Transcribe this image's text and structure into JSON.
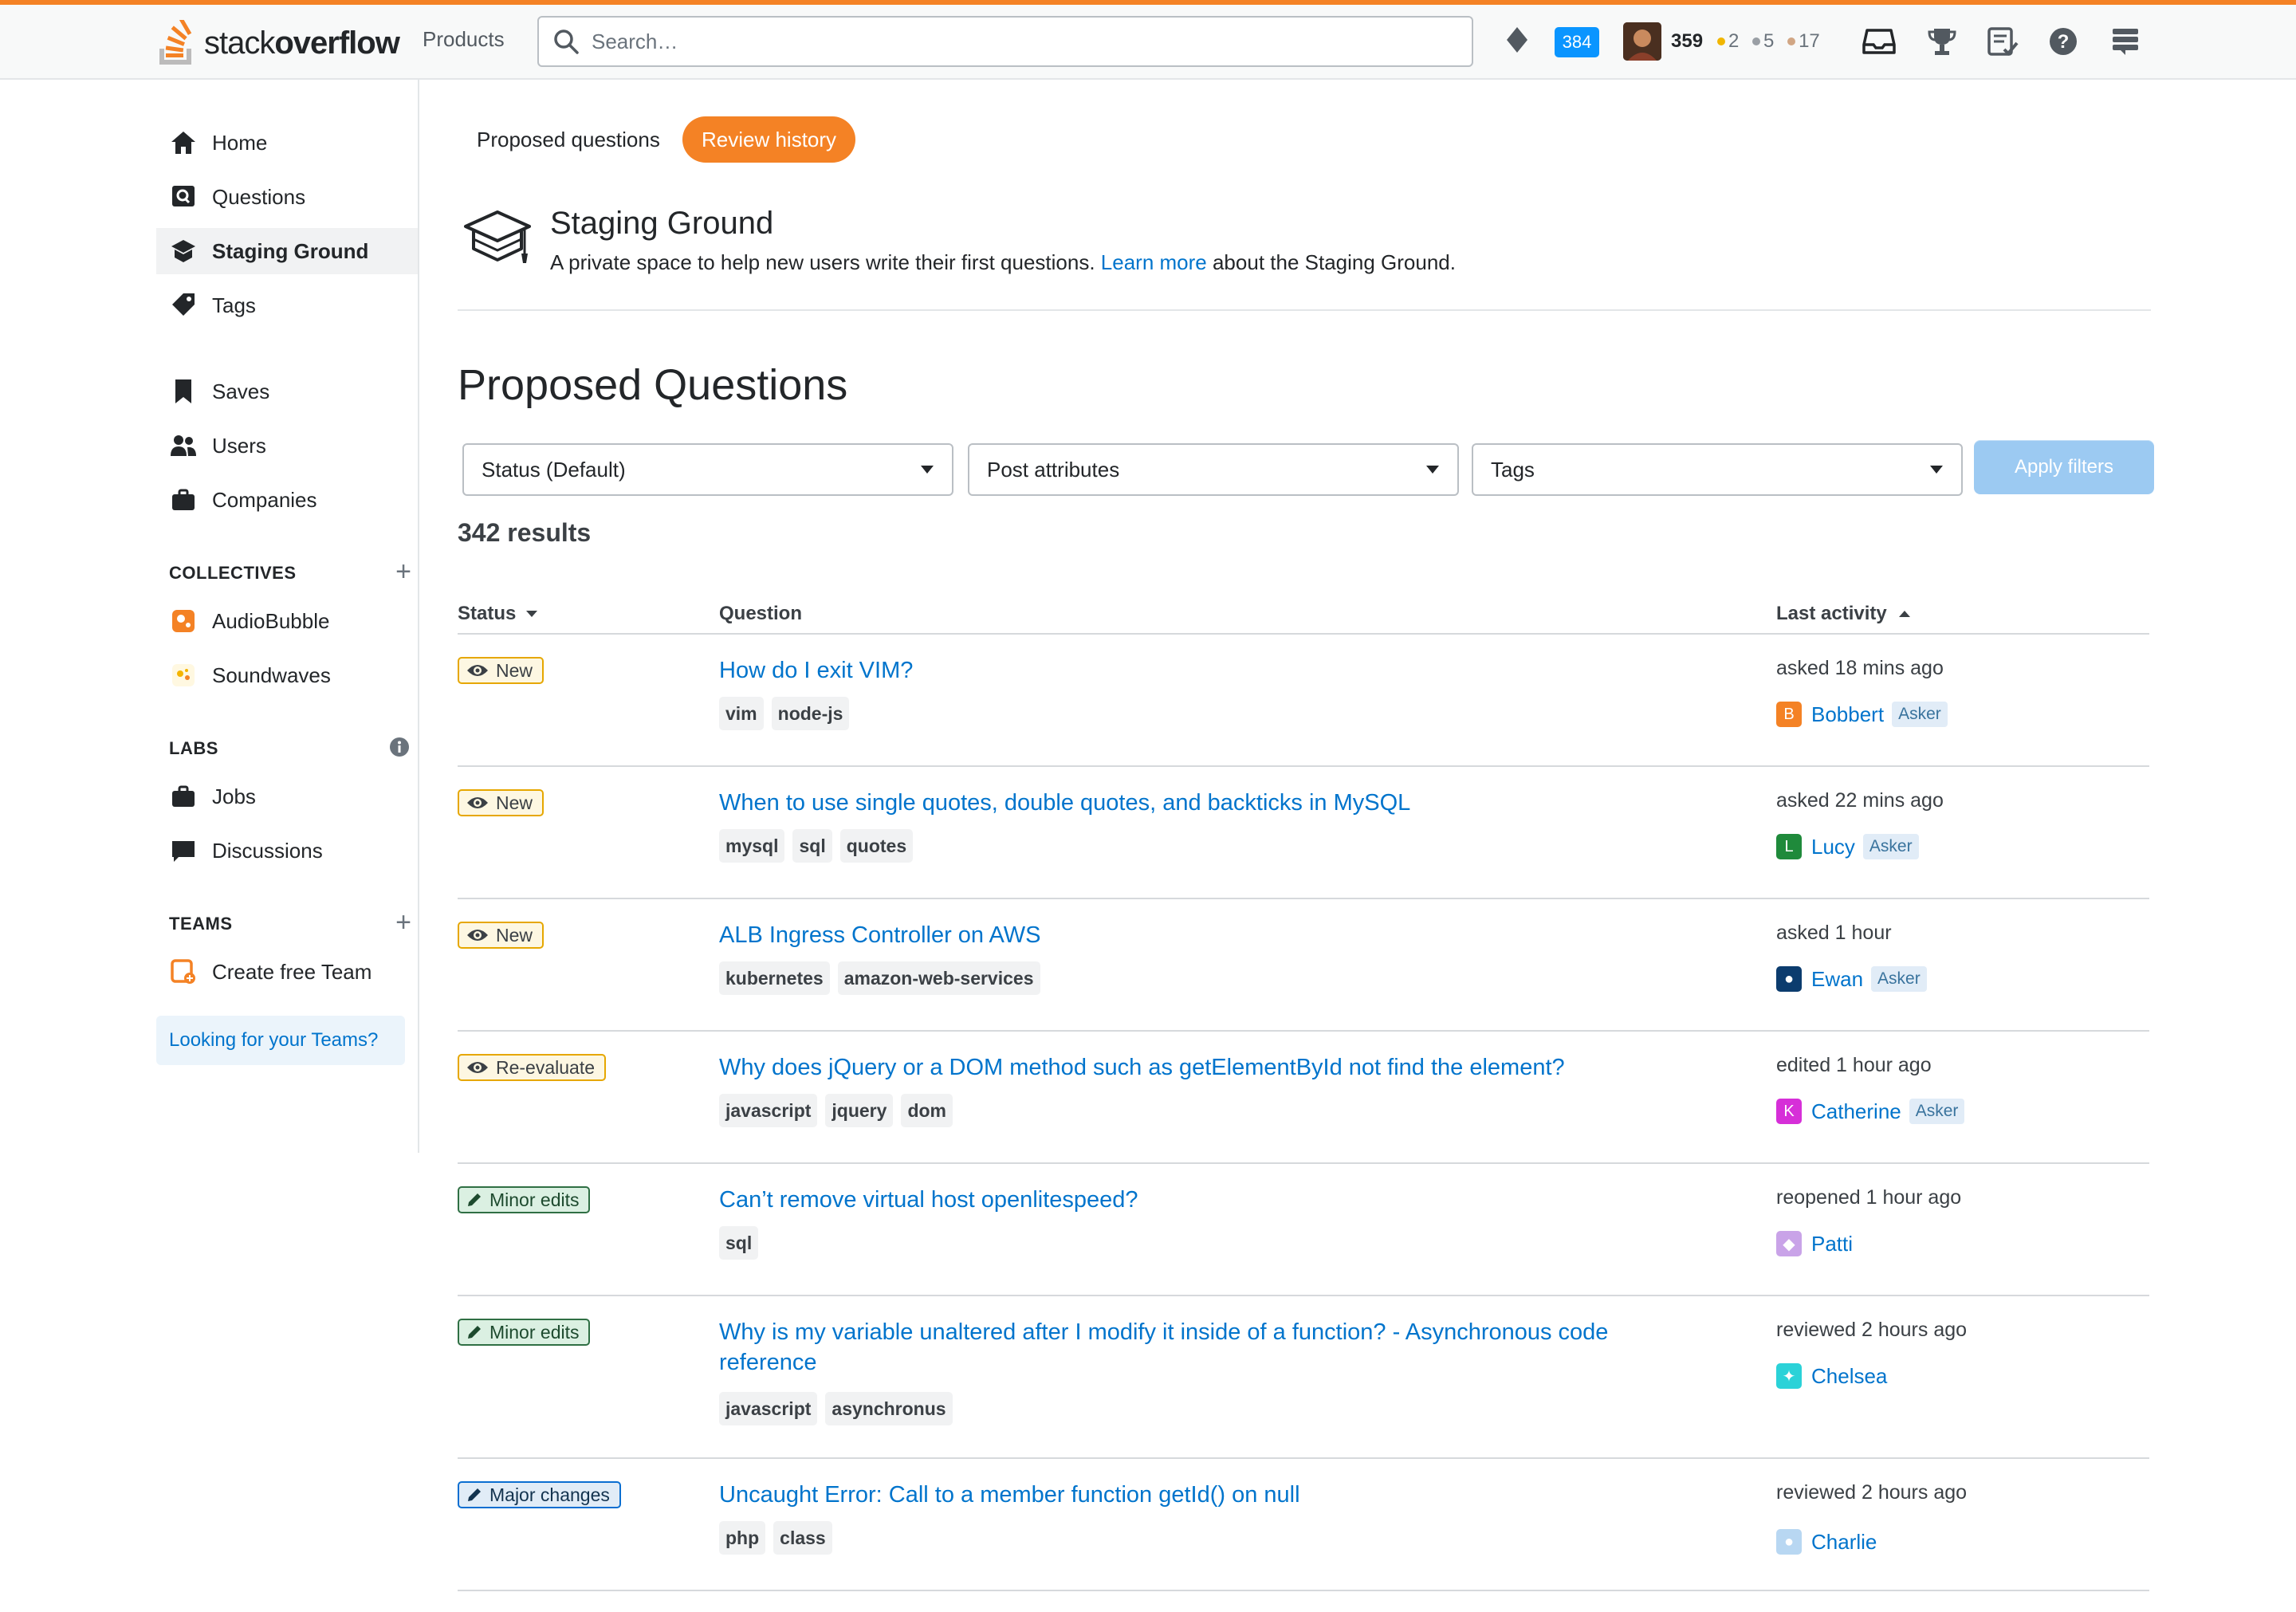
{
  "topbar": {
    "logo_light": "stack",
    "logo_bold": "overflow",
    "products": "Products",
    "search_placeholder": "Search…",
    "inbox_count": "384",
    "reputation": "359",
    "gold": "2",
    "silver": "5",
    "bronze": "17"
  },
  "sidebar": {
    "home": "Home",
    "questions": "Questions",
    "staging": "Staging Ground",
    "tags": "Tags",
    "saves": "Saves",
    "users": "Users",
    "companies": "Companies",
    "collectives_heading": "COLLECTIVES",
    "collective_1": "AudioBubble",
    "collective_2": "Soundwaves",
    "labs_heading": "LABS",
    "jobs": "Jobs",
    "discussions": "Discussions",
    "teams_heading": "TEAMS",
    "create_team": "Create free Team",
    "teams_link": "Looking for your Teams?"
  },
  "main": {
    "tab_proposed": "Proposed questions",
    "tab_history": "Review history",
    "sg_title": "Staging Ground",
    "sg_desc_pre": "A private space to help new users write their first questions. ",
    "sg_learn_more": "Learn more",
    "sg_desc_post": " about the Staging Ground.",
    "heading": "Proposed Questions",
    "filter_status": "Status (Default)",
    "filter_attributes": "Post attributes",
    "filter_tags": "Tags",
    "apply": "Apply filters",
    "results": "342 results",
    "col_status": "Status",
    "col_question": "Question",
    "col_activity": "Last activity"
  },
  "rows": [
    {
      "status": "New",
      "title": "How do I exit VIM?",
      "tags": [
        "vim",
        "node-js"
      ],
      "activity": "asked 18 mins ago",
      "user": "Bobbert",
      "initial": "B",
      "avatar_color": "#f48225",
      "asker": "Asker"
    },
    {
      "status": "New",
      "title": "When to use single quotes, double quotes, and backticks in MySQL",
      "tags": [
        "mysql",
        "sql",
        "quotes"
      ],
      "activity": "asked 22 mins ago",
      "user": "Lucy",
      "initial": "L",
      "avatar_color": "#1f8a3b",
      "asker": "Asker"
    },
    {
      "status": "New",
      "title": "ALB Ingress Controller on AWS",
      "tags": [
        "kubernetes",
        "amazon-web-services"
      ],
      "activity": "asked 1 hour",
      "user": "Ewan",
      "initial": "●",
      "avatar_color": "#0c3c6e",
      "asker": "Asker"
    },
    {
      "status": "Re-evaluate",
      "title": "Why does jQuery or a DOM method such as getElementById not find the element?",
      "tags": [
        "javascript",
        "jquery",
        "dom"
      ],
      "activity": "edited 1 hour ago",
      "user": "Catherine",
      "initial": "K",
      "avatar_color": "#d62fd8",
      "asker": "Asker"
    },
    {
      "status": "Minor edits",
      "title": "Can’t remove virtual host openlitespeed?",
      "tags": [
        "sql"
      ],
      "activity": "reopened 1 hour ago",
      "user": "Patti",
      "initial": "◆",
      "avatar_color": "#c9a3e8",
      "asker": ""
    },
    {
      "status": "Minor edits",
      "title": "Why is my variable unaltered after I modify it inside of a function? -   Asynchronous code reference",
      "tags": [
        "javascript",
        "asynchronus"
      ],
      "activity": "reviewed 2 hours ago",
      "user": "Chelsea",
      "initial": "✦",
      "avatar_color": "#2bd2d8",
      "asker": ""
    },
    {
      "status": "Major changes",
      "title": "Uncaught Error: Call to a member function getId() on null",
      "tags": [
        "php",
        "class"
      ],
      "activity": "reviewed 2 hours ago",
      "user": "Charlie",
      "initial": "●",
      "avatar_color": "#b8d7f2",
      "asker": ""
    }
  ]
}
